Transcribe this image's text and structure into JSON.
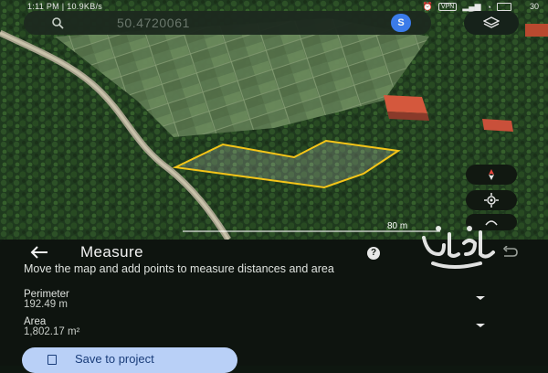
{
  "status_bar": {
    "time": "1:11 PM | 10.9KB/s",
    "icons": [
      "alarm-icon",
      "vpn-icon",
      "signal-icon",
      "wifi-icon",
      "battery-icon"
    ],
    "vpn_label": "VPN",
    "battery": "30"
  },
  "search": {
    "value": "50.4720061",
    "avatar_letter": "S"
  },
  "map": {
    "scale_label": "80 m",
    "polygon_color": "#f5c518"
  },
  "sheet": {
    "title": "Measure",
    "instruction": "Move the map and add points to measure distances and area",
    "perimeter_label": "Perimeter",
    "perimeter_value": "192.49 m",
    "area_label": "Area",
    "area_value": "1,802.17 m²",
    "save_label": "Save to project"
  },
  "watermark": {
    "text": "زمین باز"
  },
  "colors": {
    "accent": "#3c7ef2",
    "save_button_bg": "#b9d0f7",
    "sheet_bg": "#0e140f"
  }
}
